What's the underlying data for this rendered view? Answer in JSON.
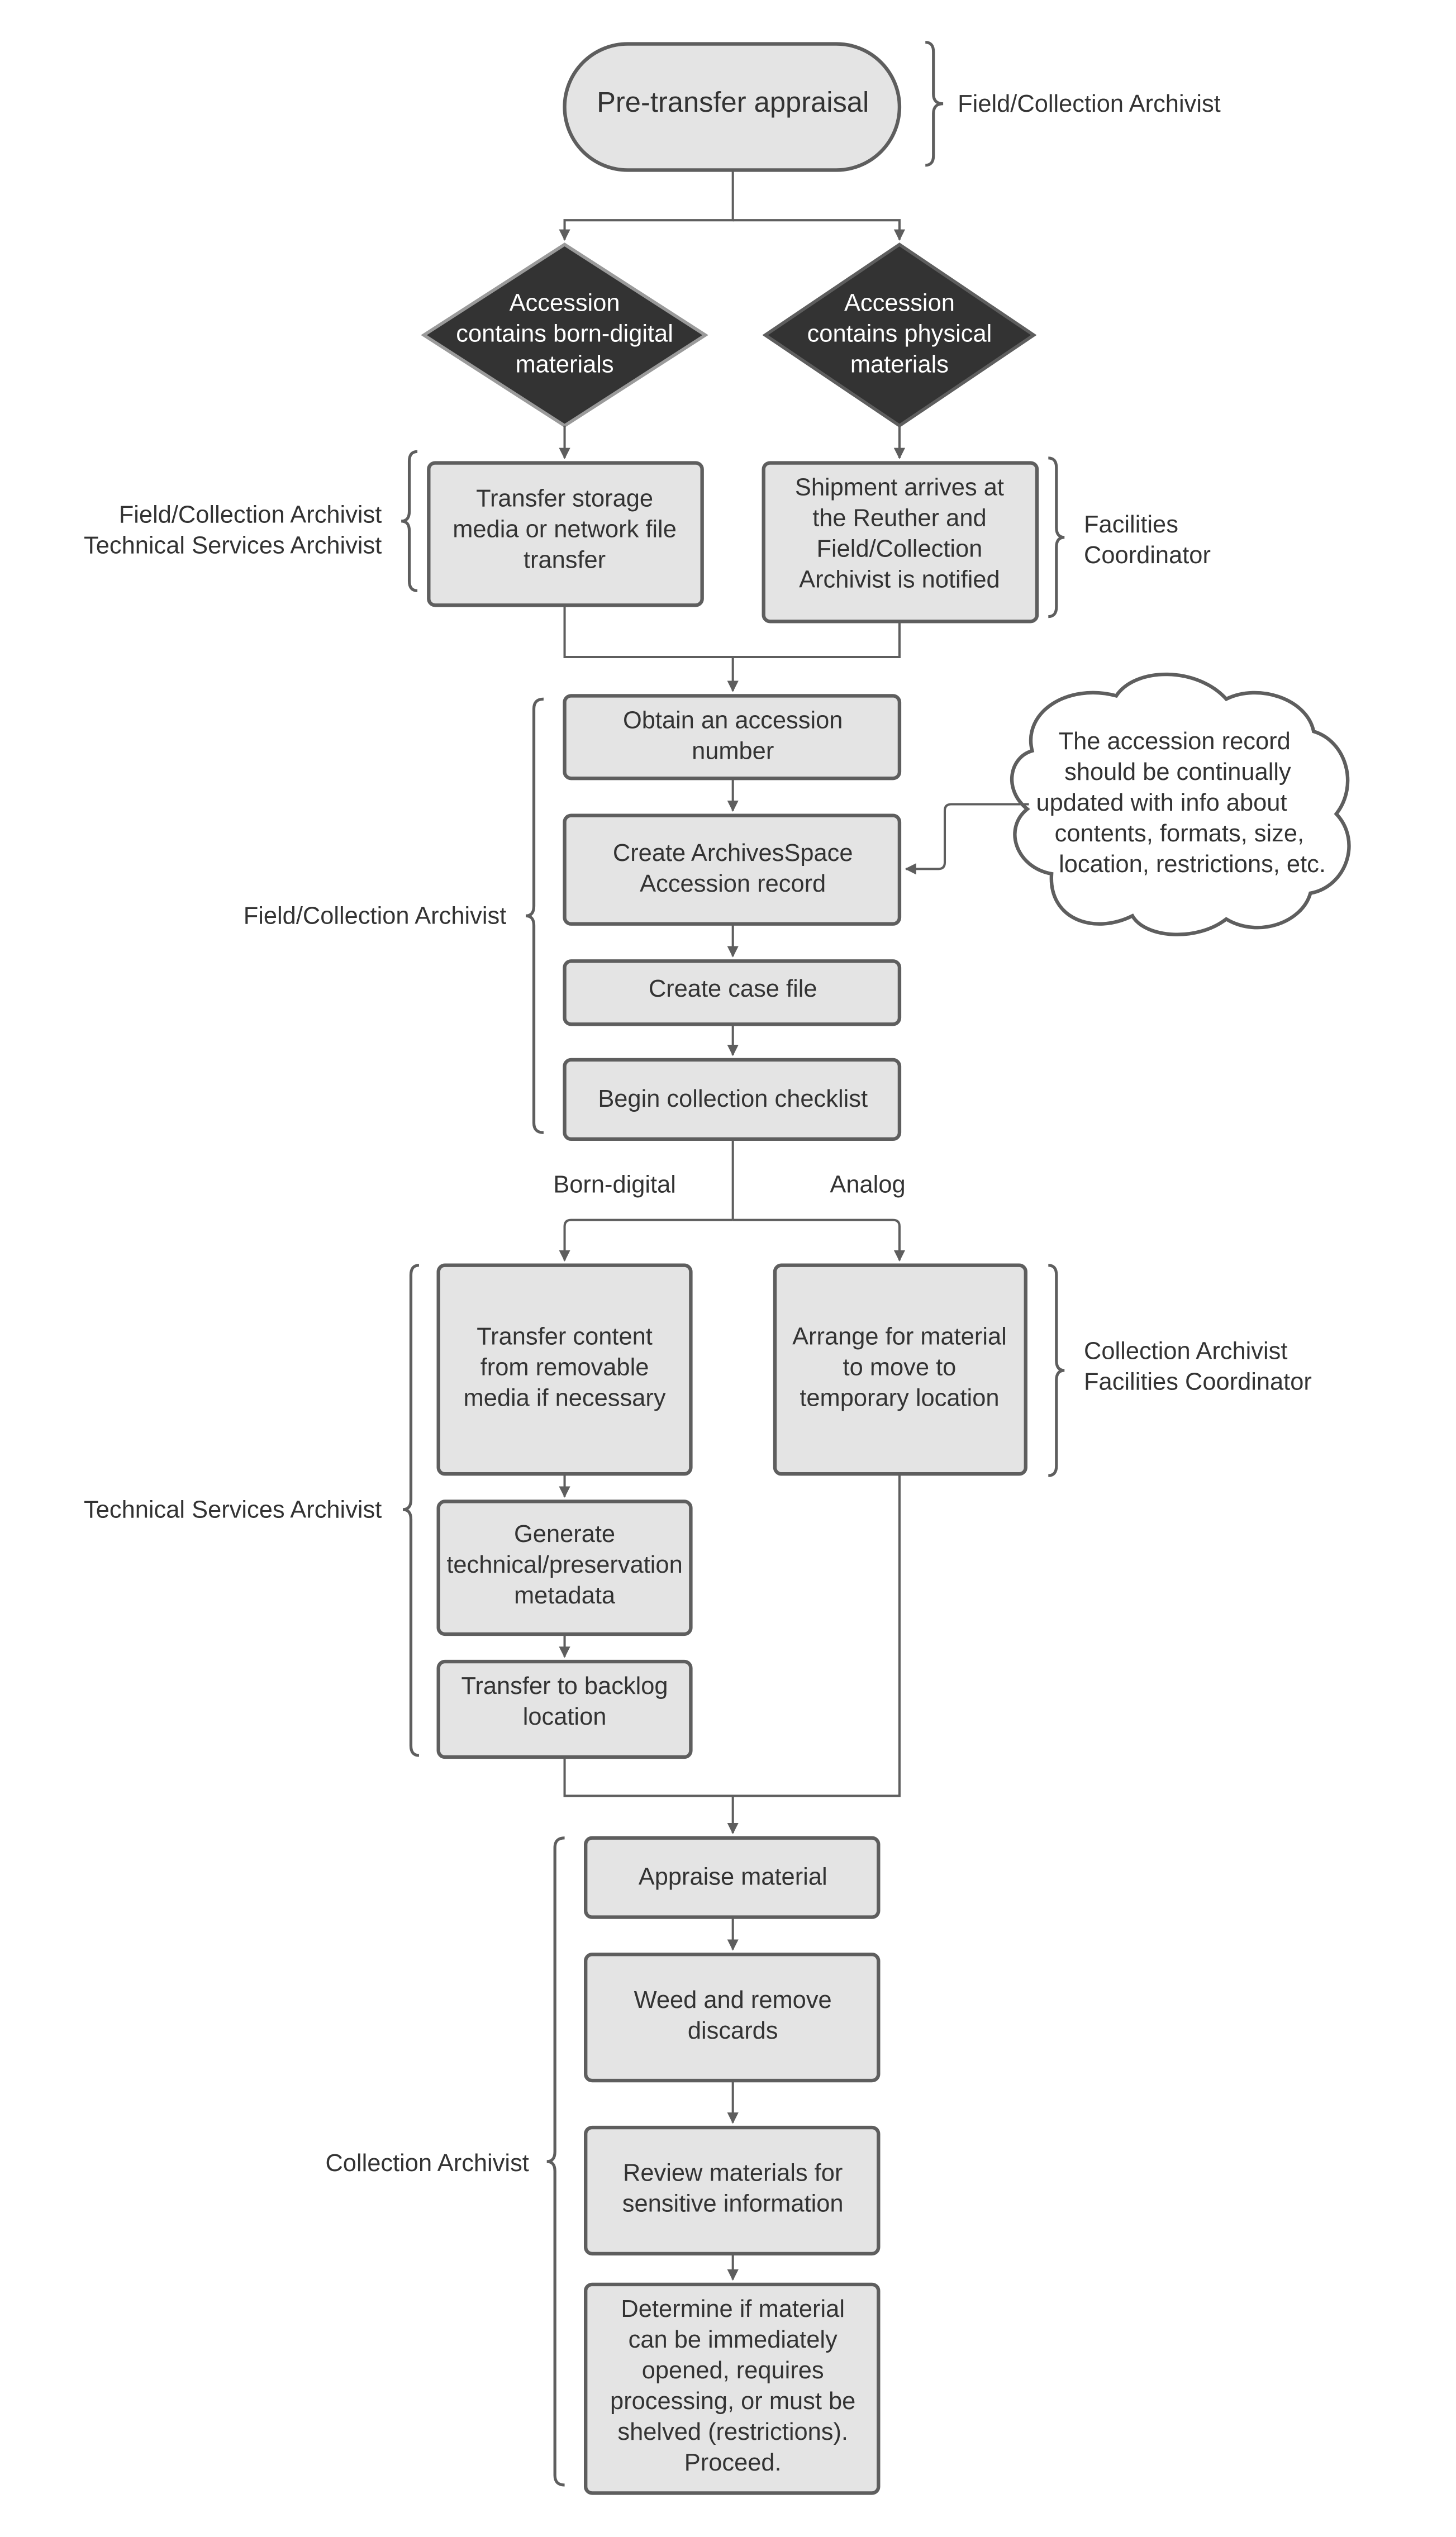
{
  "diagram": {
    "start": {
      "label": "Pre-transfer appraisal",
      "role": "Field/Collection Archivist"
    },
    "decisions": [
      {
        "lines": [
          "Accession",
          "contains born-digital",
          "materials"
        ]
      },
      {
        "lines": [
          "Accession",
          "contains physical",
          "materials"
        ]
      }
    ],
    "intake": {
      "digital": {
        "lines": [
          "Transfer storage",
          "media or network file",
          "transfer"
        ],
        "roles": [
          "Field/Collection Archivist",
          "Technical Services Archivist"
        ]
      },
      "physical": {
        "lines": [
          "Shipment arrives at",
          "the Reuther and",
          "Field/Collection",
          "Archivist is notified"
        ],
        "roles": [
          "Facilities",
          "Coordinator"
        ]
      }
    },
    "accession": {
      "role": "Field/Collection Archivist",
      "steps": [
        {
          "lines": [
            "Obtain an accession",
            "number"
          ]
        },
        {
          "lines": [
            "Create ArchivesSpace",
            "Accession record"
          ]
        },
        {
          "lines": [
            "Create case file"
          ]
        },
        {
          "lines": [
            "Begin collection checklist"
          ]
        }
      ],
      "note": {
        "lines": [
          "The accession record",
          "should be continually",
          "updated  with info about",
          "contents, formats, size,",
          "location, restrictions, etc."
        ]
      }
    },
    "branch_labels": {
      "digital": "Born-digital",
      "analog": "Analog"
    },
    "digital_path": {
      "role": "Technical Services Archivist",
      "steps": [
        {
          "lines": [
            "Transfer content",
            "from removable",
            "media if necessary"
          ]
        },
        {
          "lines": [
            "Generate",
            "technical/preservation",
            "metadata"
          ]
        },
        {
          "lines": [
            "Transfer to backlog",
            "location"
          ]
        }
      ]
    },
    "analog_path": {
      "roles": [
        "Collection Archivist",
        "Facilities Coordinator"
      ],
      "steps": [
        {
          "lines": [
            "Arrange for material",
            "to move to",
            "temporary location"
          ]
        }
      ]
    },
    "processing": {
      "role": "Collection Archivist",
      "steps": [
        {
          "lines": [
            "Appraise material"
          ]
        },
        {
          "lines": [
            "Weed and remove",
            "discards"
          ]
        },
        {
          "lines": [
            "Review materials for",
            "sensitive information"
          ]
        },
        {
          "lines": [
            "Determine if material",
            "can be immediately",
            "opened, requires",
            "processing, or must be",
            "shelved (restrictions).",
            "Proceed."
          ]
        }
      ]
    }
  }
}
